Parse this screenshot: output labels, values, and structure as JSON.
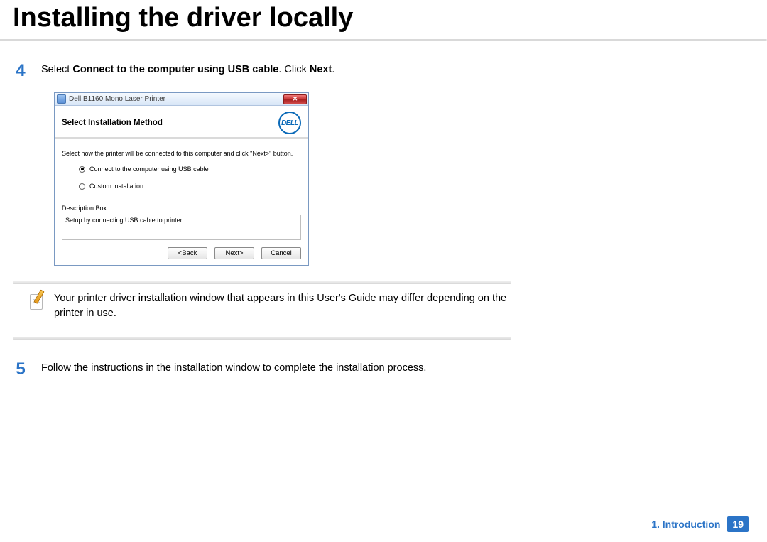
{
  "page_title": "Installing the driver locally",
  "steps": {
    "s4": {
      "num": "4",
      "t1": "Select ",
      "b1": "Connect to the computer using USB cable",
      "t2": ". Click ",
      "b2": "Next",
      "t3": "."
    },
    "s5": {
      "num": "5",
      "text": "Follow the instructions in the installation window to complete the installation process."
    }
  },
  "dialog": {
    "window_title": "Dell B1160 Mono Laser Printer",
    "close_x": "✕",
    "heading": "Select Installation Method",
    "logo": "DELL",
    "instruction": "Select how the printer will be connected to this computer and click \"Next>\" button.",
    "opt_usb": "Connect to the computer using  USB cable",
    "opt_custom": "Custom installation",
    "desc_label": "Description Box:",
    "desc_value": "Setup by connecting USB cable to printer.",
    "btn_back": "<Back",
    "btn_next": "Next>",
    "btn_cancel": "Cancel"
  },
  "note": {
    "text": "Your printer driver installation window that appears in this User's Guide may differ depending on the printer in use."
  },
  "footer": {
    "chapter": "1. Introduction",
    "page": "19"
  }
}
